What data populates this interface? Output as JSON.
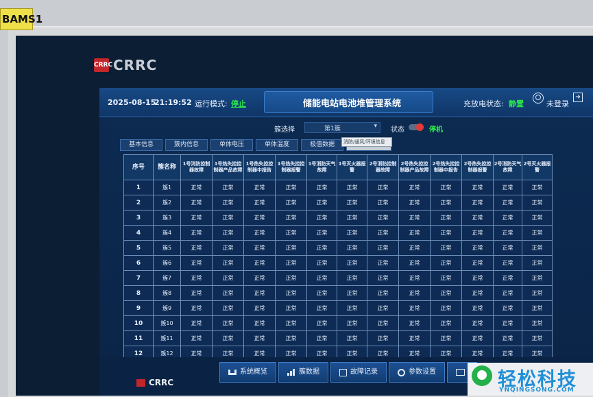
{
  "device_label": "BAMS1",
  "brand": {
    "logo_mark": "CRRC",
    "name": "CRRC"
  },
  "header": {
    "date": "2025-08-15",
    "time": "21:19:52",
    "mode_label": "运行模式:",
    "mode_value": "停止",
    "title": "储能电站电池堆管理系统",
    "charge_label": "充放电状态:",
    "charge_value": "静置",
    "user_icon": "user-icon",
    "login_text": "未登录",
    "logout_icon": "logout-icon"
  },
  "cluster": {
    "select_label": "簇选择",
    "select_value": "第1簇",
    "status_label": "状态",
    "status_value": "停机"
  },
  "tabs": [
    {
      "label": "基本信息",
      "active": false
    },
    {
      "label": "簇内信息",
      "active": false
    },
    {
      "label": "单体电压",
      "active": false
    },
    {
      "label": "单体温度",
      "active": false
    },
    {
      "label": "极值数据",
      "active": false
    },
    {
      "label": "",
      "active": true
    }
  ],
  "tooltip": "消防/通风/环境信息",
  "table": {
    "headers": [
      "序号",
      "簇名称",
      "1号消防控制器故障",
      "1号热失控控制器产品故障",
      "1号热失控控制器中报告",
      "1号热失控控制器报警",
      "1号消防天气故障",
      "1号灭火器报警",
      "2号消防控制器故障",
      "2号热失控控制器产品故障",
      "2号热失控控制器中报告",
      "2号热失控控制器报警",
      "2号消防天气故障",
      "2号灭火器报警"
    ],
    "status_text": "正常",
    "rows": [
      {
        "no": "1",
        "name": "簇1"
      },
      {
        "no": "2",
        "name": "簇2"
      },
      {
        "no": "3",
        "name": "簇3"
      },
      {
        "no": "4",
        "name": "簇4"
      },
      {
        "no": "5",
        "name": "簇5"
      },
      {
        "no": "6",
        "name": "簇6"
      },
      {
        "no": "7",
        "name": "簇7"
      },
      {
        "no": "8",
        "name": "簇8"
      },
      {
        "no": "9",
        "name": "簇9"
      },
      {
        "no": "10",
        "name": "簇10"
      },
      {
        "no": "11",
        "name": "簇11"
      },
      {
        "no": "12",
        "name": "簇12"
      }
    ]
  },
  "footer": {
    "brand": "CRRC",
    "nav": [
      {
        "label": "系统概览",
        "icon": "home-icon"
      },
      {
        "label": "簇数据",
        "icon": "chart-icon"
      },
      {
        "label": "故障记录",
        "icon": "fault-icon"
      },
      {
        "label": "参数设置",
        "icon": "gear-icon"
      },
      {
        "label": "",
        "icon": "monitor-icon"
      }
    ]
  },
  "watermark": {
    "title": "轻松科技",
    "url": "YNQINGSONG.COM"
  }
}
